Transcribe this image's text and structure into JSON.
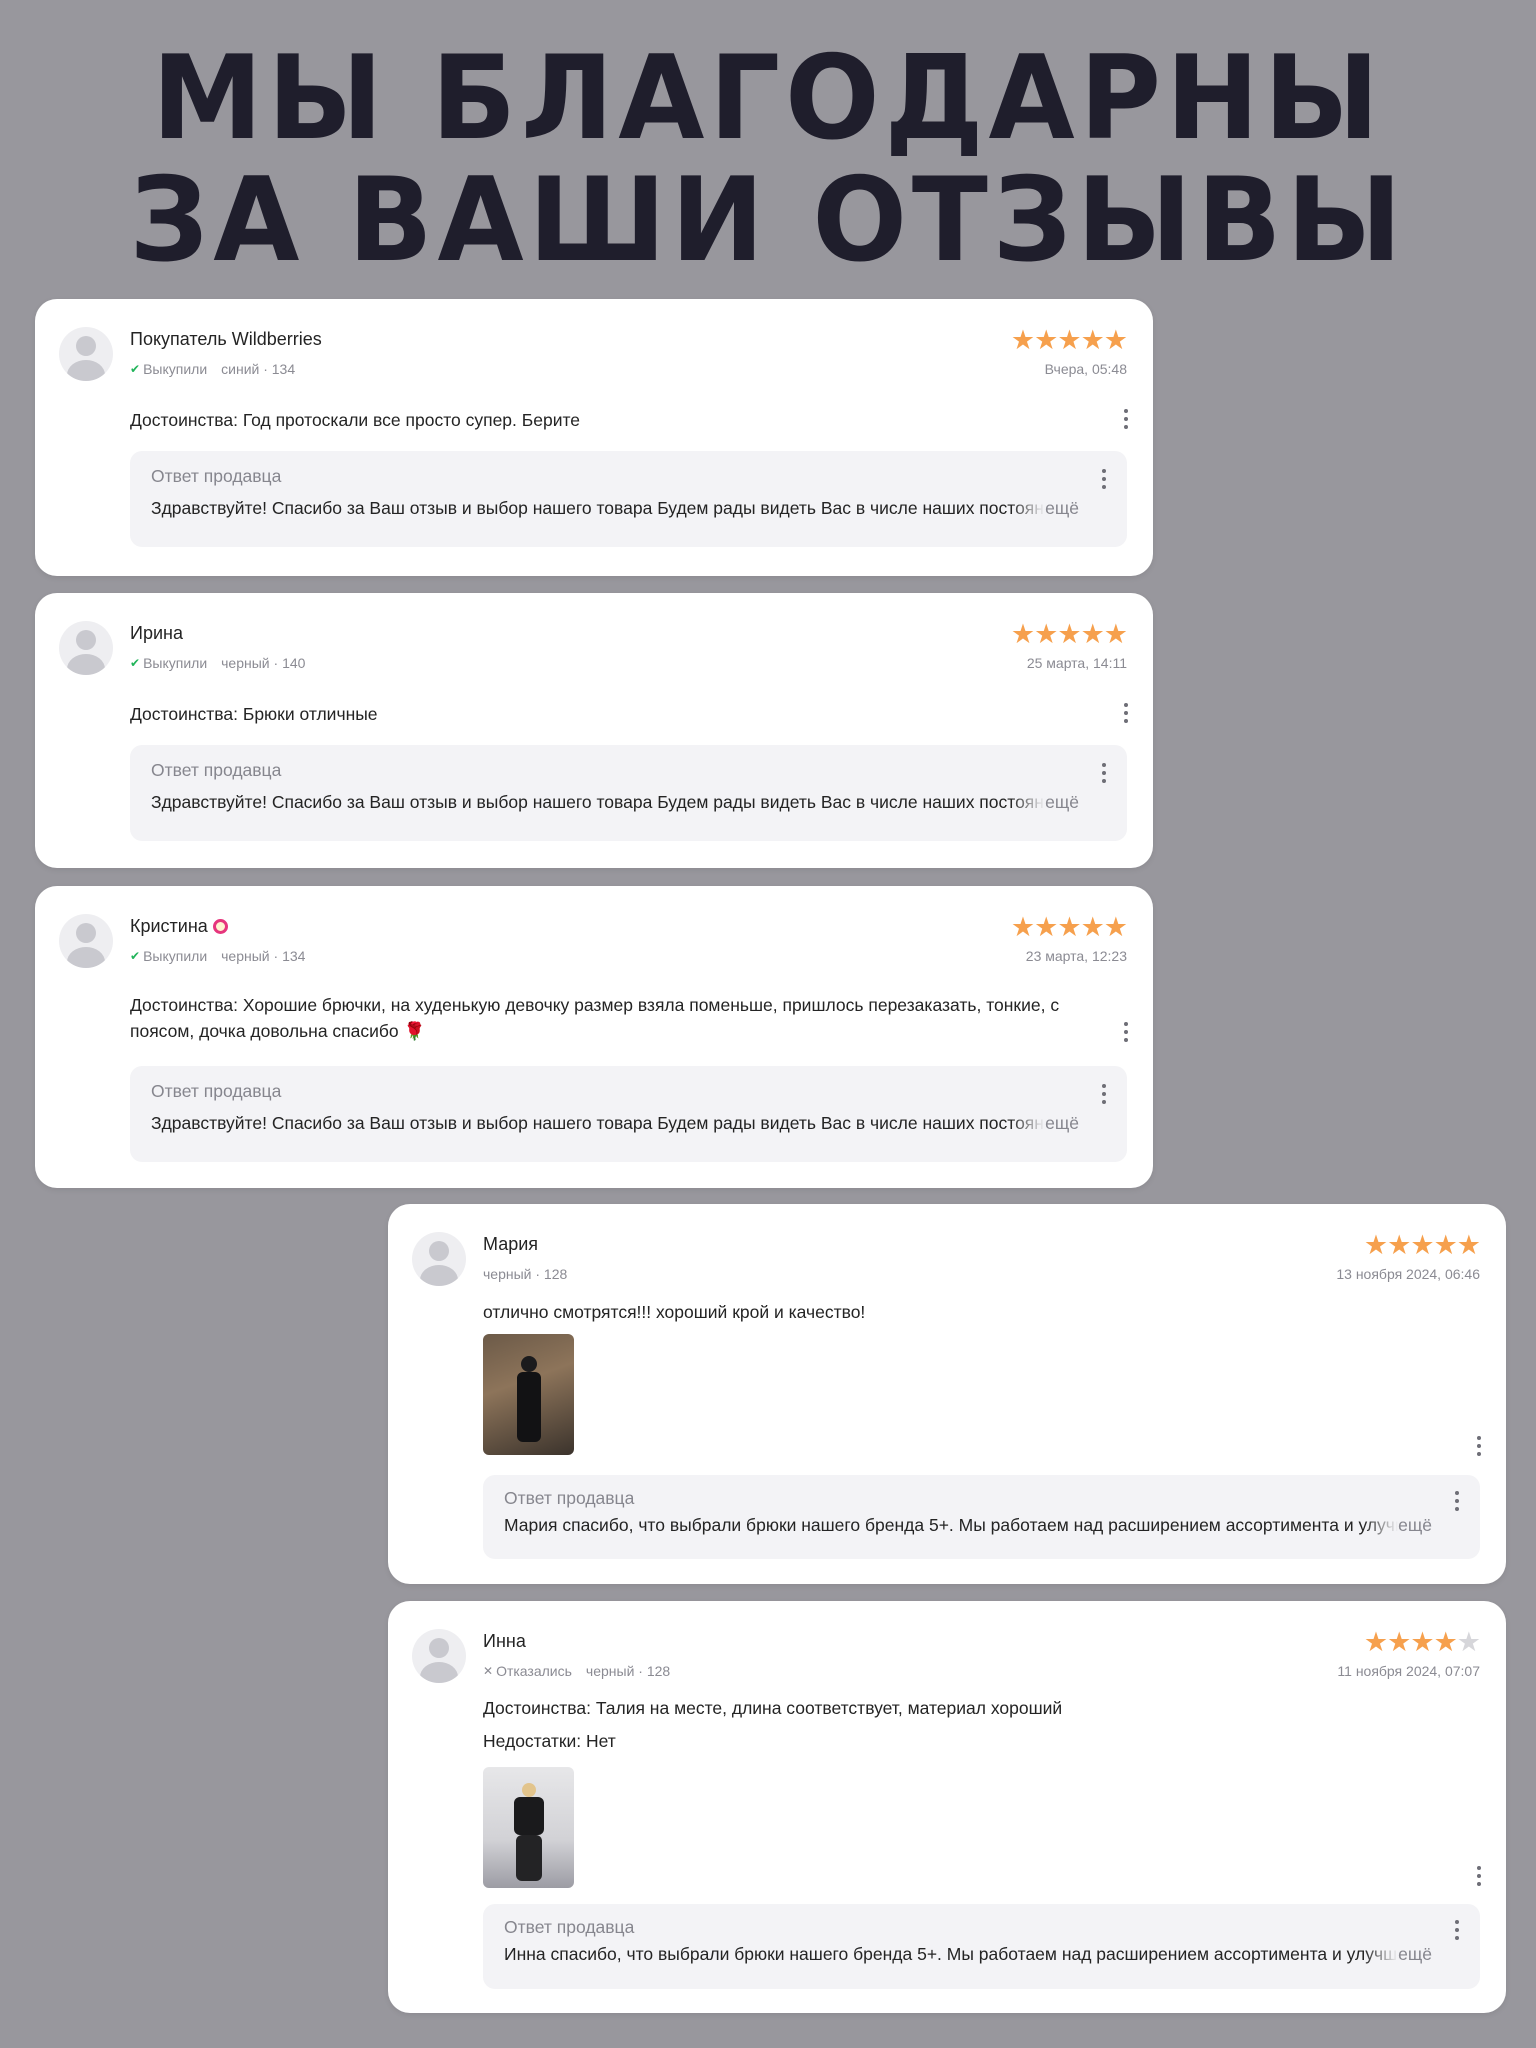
{
  "headline": {
    "line1": "МЫ БЛАГОДАРНЫ",
    "line2": "ЗА ВАШИ ОТЗЫВЫ"
  },
  "colors": {
    "background": "#98979d",
    "headline": "#1f1e2c",
    "star": "#f6a04d",
    "check": "#21b45a"
  },
  "reply_title": "Ответ продавца",
  "more_label": "ещё",
  "reviews": [
    {
      "name": "Покупатель Wildberries",
      "status": "Выкупили",
      "color_size": "синий · 134",
      "rating": 5,
      "date": "Вчера, 05:48",
      "text": "Достоинства: Год протоскали все просто супер. Берите",
      "reply": "Здравствуйте! Спасибо за Ваш отзыв и выбор нашего товара Будем рады видеть Вас в числе наших постоянных"
    },
    {
      "name": "Ирина",
      "status": "Выкупили",
      "color_size": "черный · 140",
      "rating": 5,
      "date": "25 марта, 14:11",
      "text": "Достоинства: Брюки отличные",
      "reply": "Здравствуйте! Спасибо за Ваш отзыв и выбор нашего товара Будем рады видеть Вас в числе наших постоянных"
    },
    {
      "name": "Кристина",
      "status": "Выкупили",
      "color_size": "черный · 134",
      "rating": 5,
      "date": "23 марта, 12:23",
      "text_line1": "Достоинства: Хорошие брючки, на худенькую девочку размер взяла поменьше, пришлось перезаказать, тонкие, с",
      "text_line2": "поясом, дочка довольна спасибо 🌹",
      "reply": "Здравствуйте! Спасибо за Ваш отзыв и выбор нашего товара Будем рады видеть Вас в числе наших постоянных"
    },
    {
      "name": "Мария",
      "color_size": "черный · 128",
      "rating": 5,
      "date": "13 ноября 2024, 06:46",
      "text": "отлично смотрятся!!! хороший крой и качество!",
      "reply": "Мария спасибо, что выбрали брюки нашего бренда 5+. Мы работаем над расширением ассортимента и улучшением"
    },
    {
      "name": "Инна",
      "status": "Отказались",
      "color_size": "черный · 128",
      "rating": 4,
      "date": "11 ноября 2024, 07:07",
      "text": "Достоинства: Талия на месте, длина соответствует, материал хороший",
      "text2": "Недостатки: Нет",
      "reply": "Инна спасибо, что выбрали брюки нашего бренда 5+. Мы работаем над расширением ассортимента и улучшением"
    }
  ]
}
